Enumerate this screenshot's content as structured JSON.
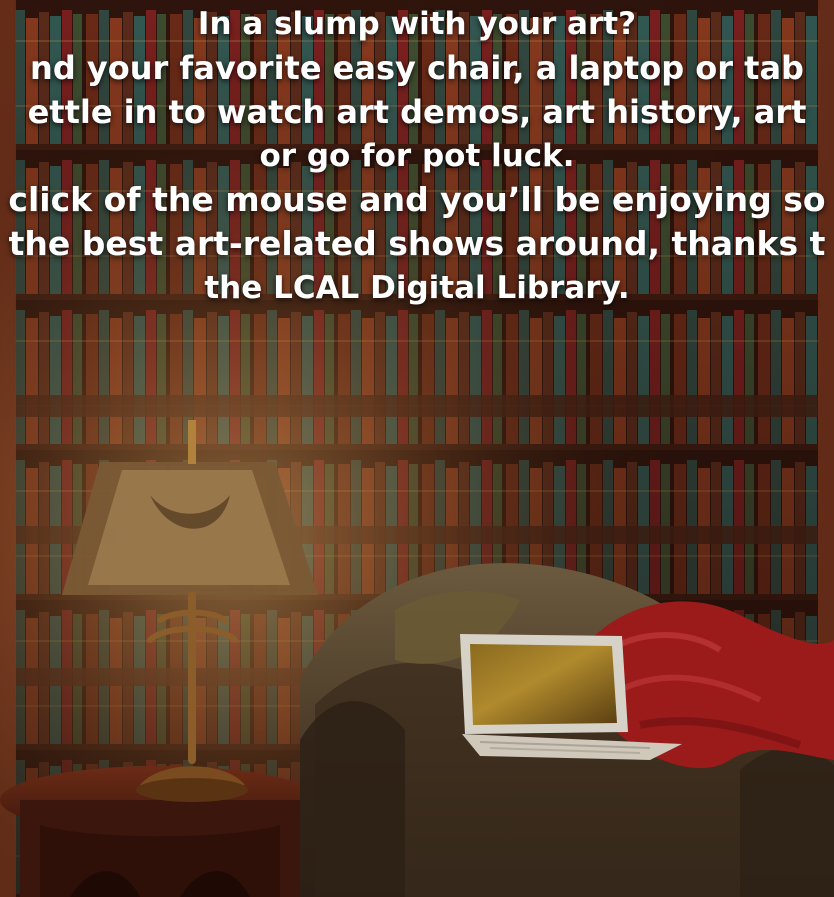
{
  "headline": {
    "line1": "In a slump with your art?",
    "line2": "nd your favorite easy chair, a laptop or tab",
    "line3": "ettle in to watch art demos, art history, art",
    "line4": "or go for pot luck.",
    "line5": "click of the mouse and you’ll be enjoying so",
    "line6": "the best art-related shows around, thanks t",
    "line7": "the LCAL Digital Library."
  },
  "colors": {
    "text": "#ffffff",
    "wood": "#5a2a16",
    "shelf": "#3a1b10"
  },
  "icons": {
    "lamp": "table-lamp-icon",
    "chair": "armchair-icon",
    "laptop": "laptop-icon",
    "blanket": "blanket-icon",
    "table": "side-table-icon"
  }
}
